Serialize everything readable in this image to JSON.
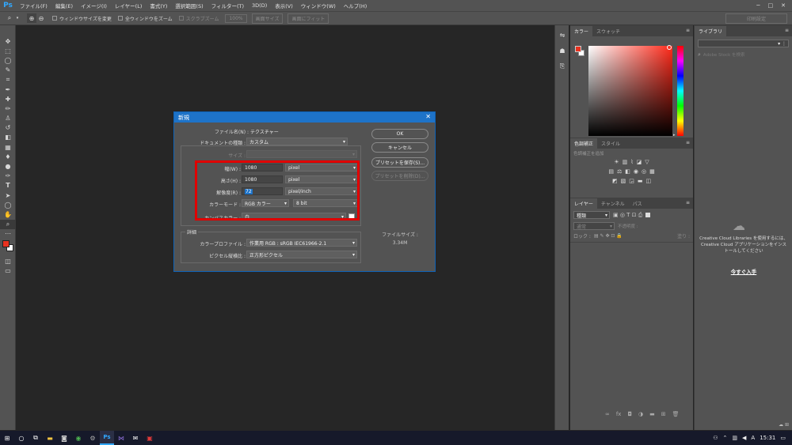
{
  "menubar": {
    "logo": "Ps",
    "items": [
      "ファイル(F)",
      "編集(E)",
      "イメージ(I)",
      "レイヤー(L)",
      "書式(Y)",
      "選択範囲(S)",
      "フィルター(T)",
      "3D(D)",
      "表示(V)",
      "ウィンドウ(W)",
      "ヘルプ(H)"
    ]
  },
  "optionsbar": {
    "resize_windows": "ウィンドウサイズを変更",
    "zoom_all": "全ウィンドウをズーム",
    "scrubby_zoom": "スクラブズーム",
    "actual_pixels": "100%",
    "fit_screen": "画面サイズ",
    "fill_screen": "画面にフィット",
    "print_size": "印刷設定"
  },
  "dialog": {
    "title": "新規",
    "file_name_label": "ファイル名(N) :",
    "file_name_value": "テクスチャー",
    "doc_type_label": "ドキュメントの種類 :",
    "doc_type_value": "カスタム",
    "size_label": "サイズ :",
    "width_label": "幅(W) :",
    "width_value": "1080",
    "width_unit": "pixel",
    "height_label": "高さ(H) :",
    "height_value": "1080",
    "height_unit": "pixel",
    "resolution_label": "解像度(R) :",
    "resolution_value": "72",
    "resolution_unit": "pixel/inch",
    "color_mode_label": "カラーモード :",
    "color_mode_value": "RGB カラー",
    "bit_depth_value": "8 bit",
    "canvas_color_label": "カンバスカラー :",
    "canvas_color_value": "白",
    "advanced_label": "詳細",
    "color_profile_label": "カラープロファイル :",
    "color_profile_value": "作業用 RGB : sRGB IEC61966-2.1",
    "pixel_aspect_label": "ピクセル縦横比 :",
    "pixel_aspect_value": "正方形ピクセル",
    "ok_label": "OK",
    "cancel_label": "キャンセル",
    "save_preset_label": "プリセットを保存(S)...",
    "delete_preset_label": "プリセットを削除(D)...",
    "file_size_label": "ファイルサイズ :",
    "file_size_value": "3.34M"
  },
  "panels": {
    "color_tabs": [
      "カラー",
      "スウォッチ"
    ],
    "adjust_tabs": [
      "色調補正",
      "スタイル"
    ],
    "adjust_hint": "色調補正を追加",
    "layer_tabs": [
      "レイヤー",
      "チャンネル",
      "パス"
    ],
    "layer_kind": "種類",
    "blend_mode": "通常",
    "opacity_label": "不透明度 :",
    "lock_label": "ロック :",
    "fill_label": "塗り :"
  },
  "library": {
    "tab": "ライブラリ",
    "search_placeholder": "Adobe Stock を検索",
    "message": "Creative Cloud Libraries を使用するには、Creative Cloud アプリケーションをインストールしてください",
    "install_link": "今すぐ入手"
  },
  "taskbar": {
    "time": "15:31",
    "ime": "A"
  },
  "colors": {
    "highlight": "#e00000",
    "foreground": "#e8311f",
    "background": "#ffffff",
    "ps_blue": "#31a8ff"
  }
}
